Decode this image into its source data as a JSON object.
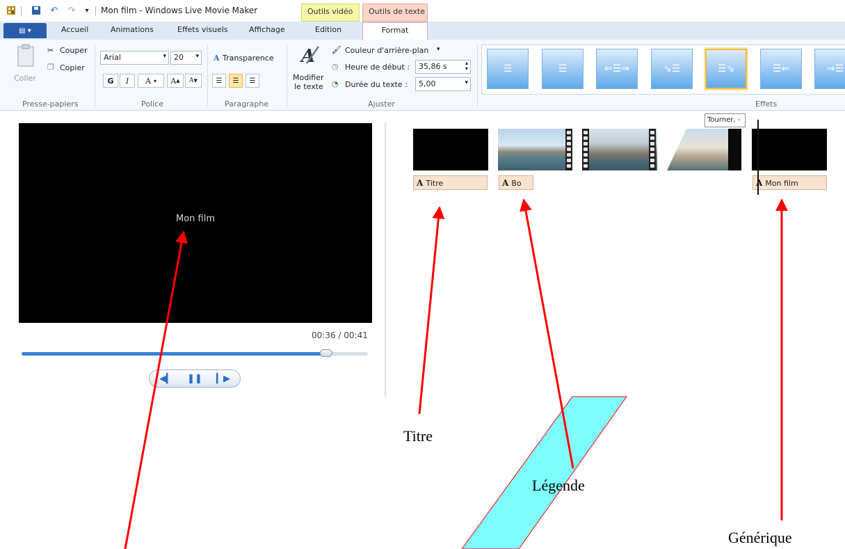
{
  "window": {
    "title": "Mon film - Windows Live Movie Maker",
    "context_tabs": {
      "video": "Outils vidéo",
      "text": "Outils de texte"
    }
  },
  "tabs": {
    "home": "Accueil",
    "animations": "Animations",
    "visual_effects": "Effets visuels",
    "view": "Affichage",
    "edit": "Edition",
    "format": "Format"
  },
  "ribbon": {
    "clipboard": {
      "label": "Presse-papiers",
      "paste": "Coller",
      "cut": "Couper",
      "copy": "Copier"
    },
    "font": {
      "label": "Police",
      "family": "Arial",
      "size": "20",
      "bold": "G",
      "italic": "I",
      "color": "A",
      "grow": "A",
      "shrink": "A",
      "transparency": "Transparence"
    },
    "paragraph": {
      "label": "Paragraphe"
    },
    "adjust": {
      "label": "Ajuster",
      "edit_text_line1": "Modifier",
      "edit_text_line2": "le texte",
      "bg_color": "Couleur d'arrière-plan",
      "start_time_label": "Heure de début :",
      "start_time_value": "35,86 s",
      "duration_label": "Durée du texte :",
      "duration_value": "5,00"
    },
    "effects": {
      "label": "Effets"
    }
  },
  "preview": {
    "text": "Mon film",
    "timecode": "00:36 / 00:41",
    "progress_fraction": 0.88
  },
  "storyboard": {
    "captions": {
      "title": "Titre",
      "caption": "Bo",
      "credits": "Mon film"
    },
    "tooltip": "Tourner, -"
  },
  "annotations": {
    "titre": "Titre",
    "legende": "Légende",
    "generique": "Générique"
  },
  "colors": {
    "arrow": "#ff0000",
    "band": "#7ffcfc"
  }
}
